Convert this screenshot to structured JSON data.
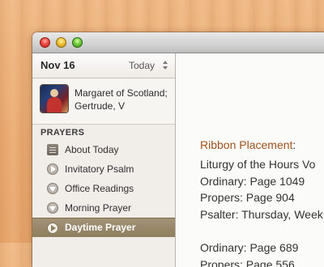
{
  "window": {
    "controls": [
      "close",
      "minimize",
      "zoom"
    ],
    "colors": {
      "close": "#ee4a3f",
      "minimize": "#f2c236",
      "zoom": "#6fcc3a"
    }
  },
  "sidebar": {
    "date": "Nov 16",
    "date_selector": {
      "value": "Today",
      "icon": "updown-icon"
    },
    "saint": {
      "name": "Margaret of Scotland; Gertrude, V",
      "image": "saint-portrait"
    },
    "section_title": "PRAYERS",
    "items": [
      {
        "label": "About Today",
        "icon": "document-icon",
        "selected": false
      },
      {
        "label": "Invitatory Psalm",
        "icon": "play-icon",
        "selected": false
      },
      {
        "label": "Office Readings",
        "icon": "download-icon",
        "selected": false
      },
      {
        "label": "Morning Prayer",
        "icon": "download-icon",
        "selected": false
      },
      {
        "label": "Daytime Prayer",
        "icon": "play-icon",
        "selected": true
      }
    ],
    "selected_color": "#8f7e60"
  },
  "content": {
    "heading": "Ribbon Placement",
    "heading_color": "#a0521a",
    "lines_group1": [
      "Liturgy of the Hours Vo",
      "Ordinary: Page 1049",
      "Propers: Page 904",
      "Psalter: Thursday, Week"
    ],
    "lines_group2": [
      "Ordinary: Page 689",
      "Propers: Page 556"
    ]
  }
}
